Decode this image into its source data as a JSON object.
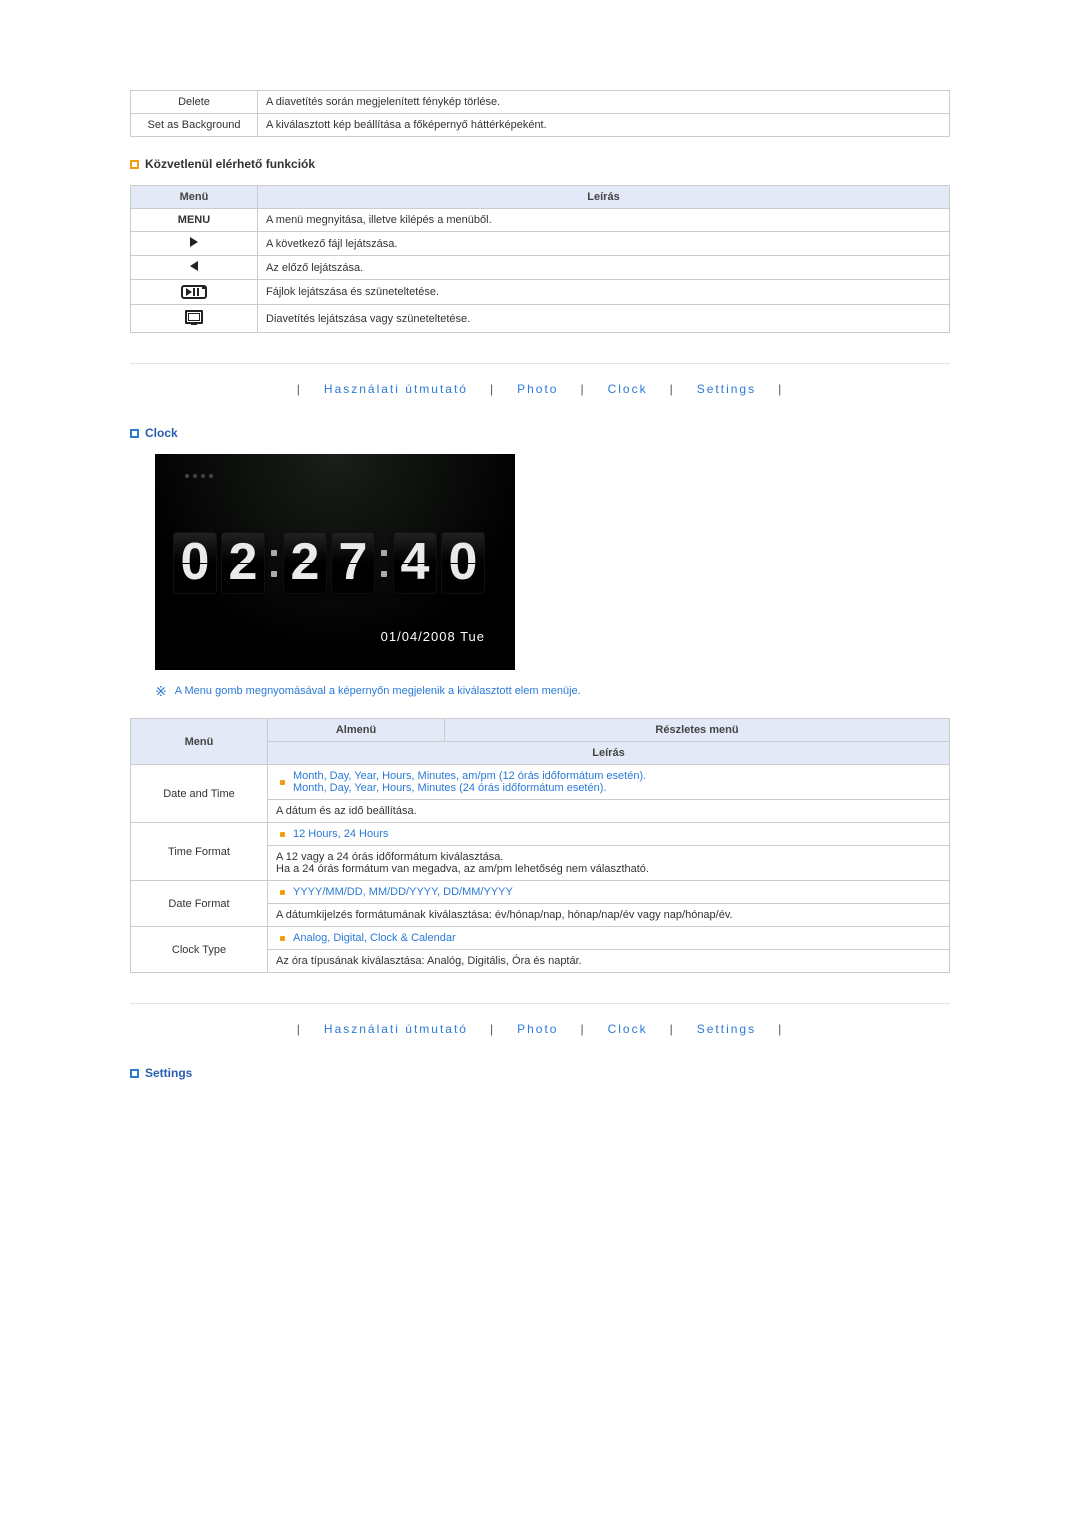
{
  "top_table": {
    "rows": [
      {
        "label": "Delete",
        "desc": "A diavetítés során megjelenített fénykép törlése."
      },
      {
        "label": "Set as Background",
        "desc": "A kiválasztott kép beállítása a főképernyő háttérképeként."
      }
    ]
  },
  "direct_section": {
    "title": "Közvetlenül elérhető funkciók",
    "headers": {
      "menu": "Menü",
      "desc": "Leírás"
    },
    "rows": [
      {
        "icon": "menu-text",
        "label": "MENU",
        "desc": "A menü megnyitása, illetve kilépés a menüből."
      },
      {
        "icon": "triangle-right",
        "label": "",
        "desc": "A következő fájl lejátszása."
      },
      {
        "icon": "triangle-left",
        "label": "",
        "desc": "Az előző lejátszása."
      },
      {
        "icon": "play-pause",
        "label": "",
        "desc": "Fájlok lejátszása és szüneteltetése."
      },
      {
        "icon": "slideshow",
        "label": "",
        "desc": "Diavetítés lejátszása vagy szüneteltetése."
      }
    ]
  },
  "nav": {
    "items": [
      "Használati útmutató",
      "Photo",
      "Clock",
      "Settings"
    ]
  },
  "clock_section": {
    "title": "Clock",
    "digits": [
      "0",
      "2",
      "2",
      "7",
      "4",
      "0"
    ],
    "date_text": "01/04/2008 Tue",
    "note": "A Menu gomb megnyomásával a képernyőn megjelenik a kiválasztott elem menüje."
  },
  "clock_table": {
    "headers": {
      "menu": "Menü",
      "submenu": "Almenü",
      "detail": "Részletes menü",
      "desc": "Leírás"
    },
    "rows": [
      {
        "label": "Date and Time",
        "options": "Month, Day, Year, Hours, Minutes, am/pm (12 órás időformátum esetén).\nMonth, Day, Year, Hours, Minutes (24 órás időformátum esetén).",
        "desc": "A dátum és az idő beállítása."
      },
      {
        "label": "Time Format",
        "options": "12 Hours, 24 Hours",
        "desc": "A 12 vagy a 24 órás időformátum kiválasztása.\nHa a 24 órás formátum van megadva, az am/pm lehetőség nem választható."
      },
      {
        "label": "Date Format",
        "options": "YYYY/MM/DD, MM/DD/YYYY, DD/MM/YYYY",
        "desc": "A dátumkijelzés formátumának kiválasztása: év/hónap/nap, hónap/nap/év vagy nap/hónap/év."
      },
      {
        "label": "Clock Type",
        "options": "Analog, Digital, Clock & Calendar",
        "desc": "Az óra típusának kiválasztása: Analóg, Digitális, Óra és naptár."
      }
    ]
  },
  "settings_section": {
    "title": "Settings"
  }
}
